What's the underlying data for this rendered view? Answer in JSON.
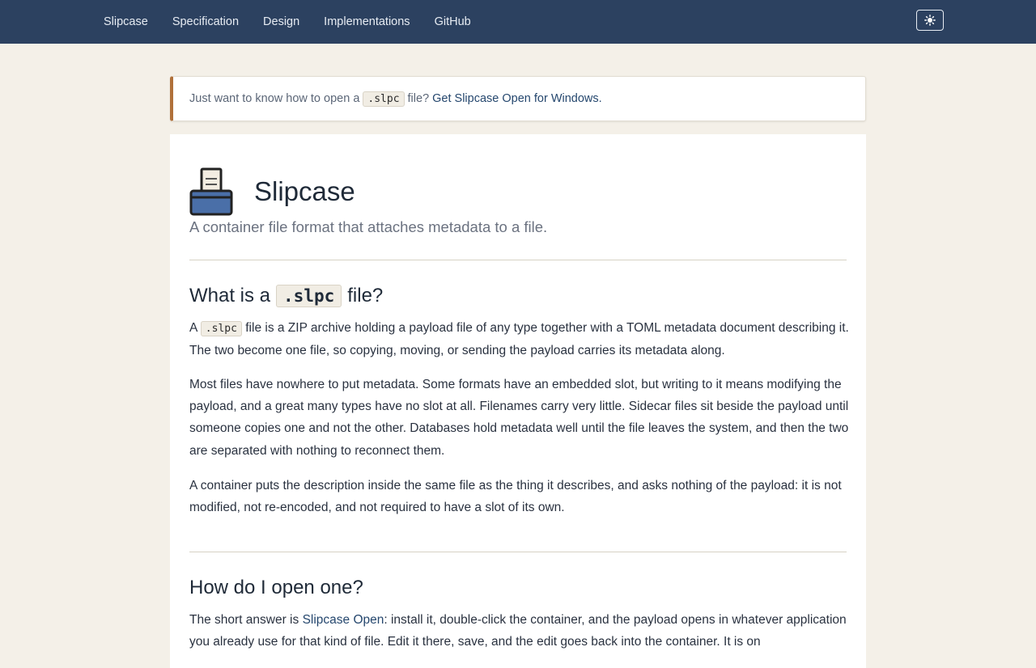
{
  "nav": {
    "links": [
      "Slipcase",
      "Specification",
      "Design",
      "Implementations",
      "GitHub"
    ],
    "theme_toggle_icon": "sun-icon"
  },
  "notice": {
    "before": "Just want to know how to open a",
    "code": ".slpc",
    "after": "file?",
    "link": "Get Slipcase Open for Windows."
  },
  "hero": {
    "logo_icon": "slipcase-tray-icon",
    "title": "Slipcase",
    "tagline": "A container file format that attaches metadata to a file."
  },
  "section1": {
    "heading_before": "What is a",
    "heading_code": ".slpc",
    "heading_after": "file?",
    "p1_before": "A",
    "p1_code": ".slpc",
    "p1_after": "file is a ZIP archive holding a payload file of any type together with a TOML metadata document describing it. The two become one file, so copying, moving, or sending the payload carries its metadata along.",
    "p2": "Most files have nowhere to put metadata. Some formats have an embedded slot, but writing to it means modifying the payload, and a great many types have no slot at all. Filenames carry very little. Sidecar files sit beside the payload until someone copies one and not the other. Databases hold metadata well until the file leaves the system, and then the two are separated with nothing to reconnect them.",
    "p3": "A container puts the description inside the same file as the thing it describes, and asks nothing of the payload: it is not modified, not re-encoded, and not required to have a slot of its own."
  },
  "section2": {
    "heading": "How do I open one?",
    "p1_before": "The short answer is",
    "p1_link": "Slipcase Open",
    "p1_after": ": install it, double-click the container, and the payload opens in whatever application you already use for that kind of file. Edit it there, save, and the edit goes back into the container. It is on"
  },
  "colors": {
    "nav_bg": "#2c4160",
    "page_bg": "#f4f0e8",
    "notice_accent": "#b0703a",
    "link": "#25476e",
    "logo_blue": "#4a6fa8"
  }
}
